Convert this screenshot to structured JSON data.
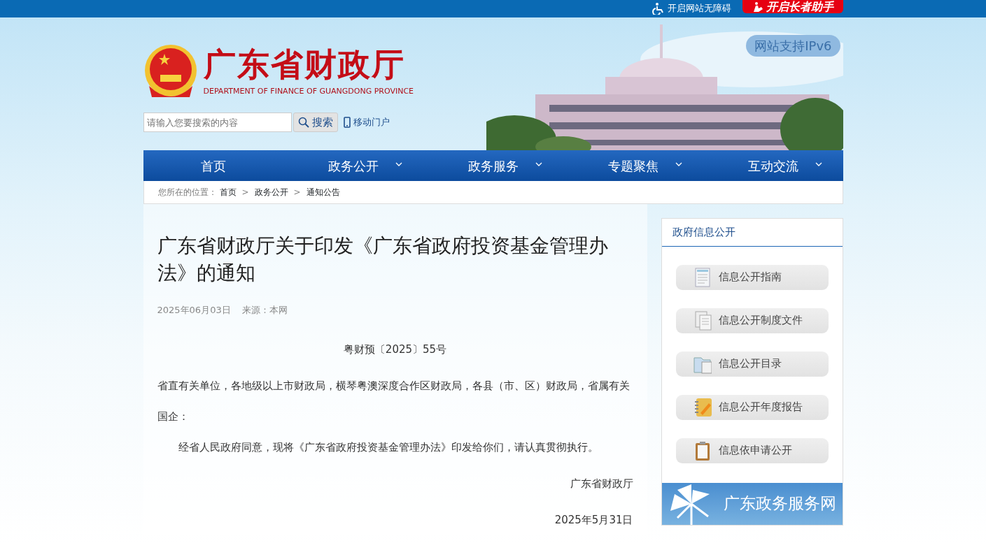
{
  "top_bar": {
    "accessibility": "开启网站无障碍",
    "elder_mode": "开启长者助手"
  },
  "header": {
    "title": "广东省财政厅",
    "subtitle": "DEPARTMENT OF FINANCE OF GUANGDONG PROVINCE",
    "ipv6": "网站支持IPv6",
    "search": {
      "placeholder": "请输入您要搜索的内容",
      "button": "搜索"
    },
    "mobile": "移动门户"
  },
  "nav": [
    {
      "label": "首页",
      "dropdown": false
    },
    {
      "label": "政务公开",
      "dropdown": true
    },
    {
      "label": "政务服务",
      "dropdown": true
    },
    {
      "label": "专题聚焦",
      "dropdown": true
    },
    {
      "label": "互动交流",
      "dropdown": true
    }
  ],
  "breadcrumb": {
    "prefix": "您所在的位置：",
    "items": [
      "首页",
      "政务公开",
      "通知公告"
    ],
    "separator": ">"
  },
  "article": {
    "title": "广东省财政厅关于印发《广东省政府投资基金管理办法》的通知",
    "date": "2025年06月03日",
    "source": "来源：本网",
    "doc_number": "粤财预〔2025〕55号",
    "recipients": "省直有关单位，各地级以上市财政局，横琴粤澳深度合作区财政局，各县（市、区）财政局，省属有关国企：",
    "body": "经省人民政府同意，现将《广东省政府投资基金管理办法》印发给你们，请认真贯彻执行。",
    "signature": "广东省财政厅",
    "sign_date": "2025年5月31日"
  },
  "sidebar": {
    "title": "政府信息公开",
    "items": [
      {
        "label": "信息公开指南",
        "kind": "guide"
      },
      {
        "label": "信息公开制度文件",
        "kind": "files"
      },
      {
        "label": "信息公开目录",
        "kind": "folder"
      },
      {
        "label": "信息公开年度报告",
        "kind": "notebook"
      },
      {
        "label": "信息依申请公开",
        "kind": "clipboard"
      }
    ],
    "banner": "广东政务服务网"
  }
}
